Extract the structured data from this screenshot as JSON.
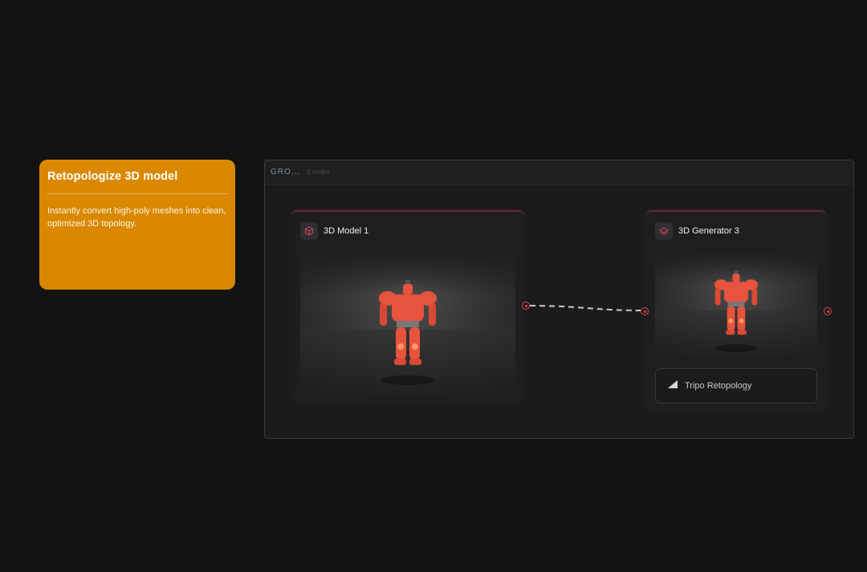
{
  "note": {
    "title": "Retopologize 3D model",
    "body": "Instantly convert high-poly meshes into clean, optimized 3D topology."
  },
  "group": {
    "name": "GRO...",
    "count": "2 nodes"
  },
  "nodes": [
    {
      "title": "3D Model 1",
      "icon": "cube-icon"
    },
    {
      "title": "3D Generator 3",
      "icon": "layers-icon",
      "model_select": "Tripo Retopology",
      "model_icon": "triangle-mesh-icon"
    }
  ],
  "colors": {
    "background": "#131313",
    "note": "#d98800",
    "port": "#e0455a",
    "robot": "#e8533d"
  }
}
